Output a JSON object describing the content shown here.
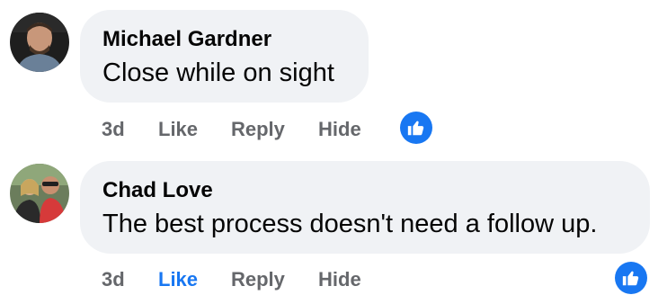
{
  "comments": [
    {
      "author": "Michael Gardner",
      "text": "Close while on sight",
      "time": "3d",
      "actions": {
        "like": "Like",
        "reply": "Reply",
        "hide": "Hide"
      },
      "liked": false,
      "reaction_icon": "thumbs-up-icon"
    },
    {
      "author": "Chad Love",
      "text": "The best process doesn't need a follow up.",
      "time": "3d",
      "actions": {
        "like": "Like",
        "reply": "Reply",
        "hide": "Hide"
      },
      "liked": true,
      "reaction_icon": "thumbs-up-icon"
    }
  ],
  "colors": {
    "bubble": "#f0f2f5",
    "text": "#050505",
    "secondary": "#65676b",
    "accent": "#1877f2"
  }
}
